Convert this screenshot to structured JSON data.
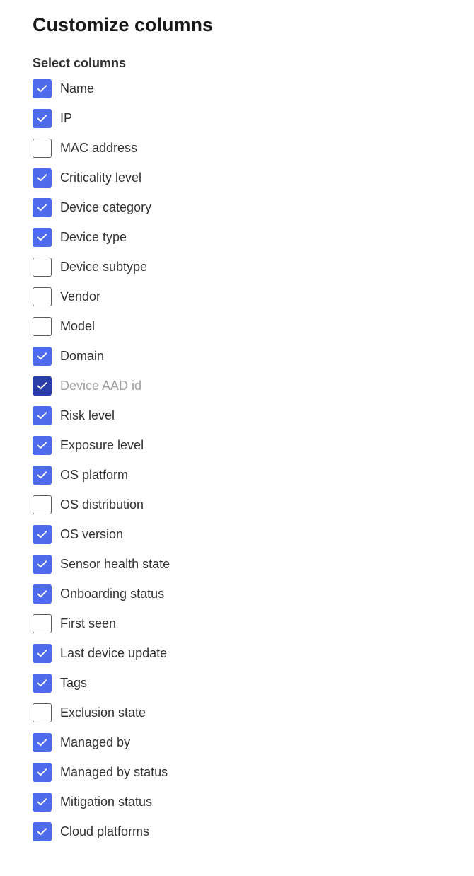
{
  "title": "Customize columns",
  "subtitle": "Select columns",
  "options": [
    {
      "label": "Name",
      "checked": true,
      "disabled": false
    },
    {
      "label": "IP",
      "checked": true,
      "disabled": false
    },
    {
      "label": "MAC address",
      "checked": false,
      "disabled": false
    },
    {
      "label": "Criticality level",
      "checked": true,
      "disabled": false
    },
    {
      "label": "Device category",
      "checked": true,
      "disabled": false
    },
    {
      "label": "Device type",
      "checked": true,
      "disabled": false
    },
    {
      "label": "Device subtype",
      "checked": false,
      "disabled": false
    },
    {
      "label": "Vendor",
      "checked": false,
      "disabled": false
    },
    {
      "label": "Model",
      "checked": false,
      "disabled": false
    },
    {
      "label": "Domain",
      "checked": true,
      "disabled": false
    },
    {
      "label": "Device AAD id",
      "checked": true,
      "disabled": true
    },
    {
      "label": "Risk level",
      "checked": true,
      "disabled": false
    },
    {
      "label": "Exposure level",
      "checked": true,
      "disabled": false
    },
    {
      "label": "OS platform",
      "checked": true,
      "disabled": false
    },
    {
      "label": "OS distribution",
      "checked": false,
      "disabled": false
    },
    {
      "label": "OS version",
      "checked": true,
      "disabled": false
    },
    {
      "label": "Sensor health state",
      "checked": true,
      "disabled": false
    },
    {
      "label": "Onboarding status",
      "checked": true,
      "disabled": false
    },
    {
      "label": "First seen",
      "checked": false,
      "disabled": false
    },
    {
      "label": "Last device update",
      "checked": true,
      "disabled": false
    },
    {
      "label": "Tags",
      "checked": true,
      "disabled": false
    },
    {
      "label": "Exclusion state",
      "checked": false,
      "disabled": false
    },
    {
      "label": "Managed by",
      "checked": true,
      "disabled": false
    },
    {
      "label": "Managed by status",
      "checked": true,
      "disabled": false
    },
    {
      "label": "Mitigation status",
      "checked": true,
      "disabled": false
    },
    {
      "label": "Cloud platforms",
      "checked": true,
      "disabled": false
    }
  ]
}
